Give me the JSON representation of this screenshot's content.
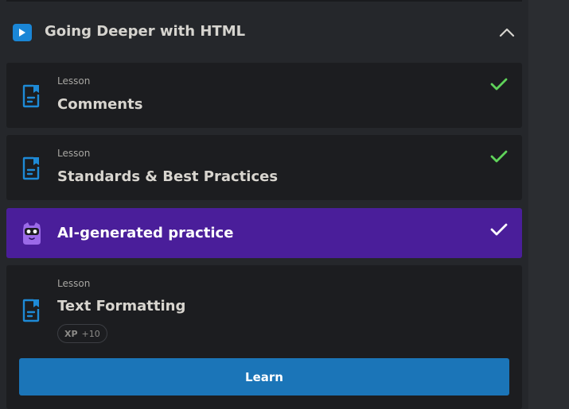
{
  "section": {
    "title": "Going Deeper with HTML",
    "icon": "play-icon",
    "toggle_icon": "chevron-up-icon"
  },
  "items": [
    {
      "kind": "Lesson",
      "title": "Comments",
      "status": "completed",
      "icon": "document-icon"
    },
    {
      "kind": "Lesson",
      "title": "Standards & Best Practices",
      "status": "completed",
      "icon": "document-icon"
    },
    {
      "kind": "",
      "title": "AI-generated practice",
      "status": "completed",
      "icon": "mascot-icon"
    },
    {
      "kind": "Lesson",
      "title": "Text Formatting",
      "status": "current",
      "icon": "document-icon",
      "xp": {
        "label": "XP",
        "value": "+10"
      },
      "action": "Learn"
    }
  ],
  "colors": {
    "accent_blue": "#1b75b8",
    "practice_purple": "#4a1e9a",
    "check_green": "#5fd35a",
    "card_bg": "#1c1d20"
  }
}
